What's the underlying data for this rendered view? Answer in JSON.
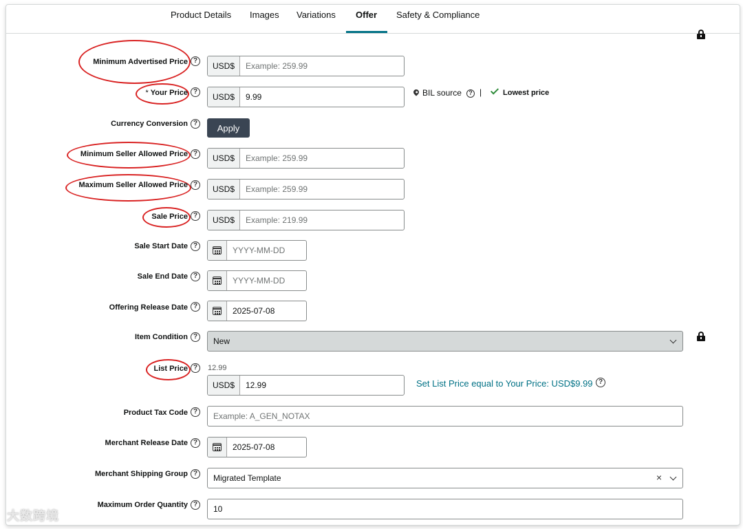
{
  "tabs": [
    {
      "label": "Product Details",
      "active": false
    },
    {
      "label": "Images",
      "active": false
    },
    {
      "label": "Variations",
      "active": false
    },
    {
      "label": "Offer",
      "active": true
    },
    {
      "label": "Safety & Compliance",
      "active": false
    }
  ],
  "accent_color": "#007185",
  "annotation_color": "#d92222",
  "fields": {
    "map": {
      "label": "Minimum Advertised Price",
      "prefix": "USD$",
      "value": "",
      "placeholder": "Example: 259.99"
    },
    "your_price": {
      "required_mark": "*",
      "label": "Your Price",
      "prefix": "USD$",
      "value": "9.99",
      "placeholder": ""
    },
    "currency": {
      "label": "Currency Conversion",
      "button": "Apply"
    },
    "min_seller": {
      "label": "Minimum Seller Allowed Price",
      "prefix": "USD$",
      "value": "",
      "placeholder": "Example: 259.99"
    },
    "max_seller": {
      "label": "Maximum Seller Allowed Price",
      "prefix": "USD$",
      "value": "",
      "placeholder": "Example: 259.99"
    },
    "sale_price": {
      "label": "Sale Price",
      "prefix": "USD$",
      "value": "",
      "placeholder": "Example: 219.99"
    },
    "sale_start": {
      "label": "Sale Start Date",
      "value": "",
      "placeholder": "YYYY-MM-DD"
    },
    "sale_end": {
      "label": "Sale End Date",
      "value": "",
      "placeholder": "YYYY-MM-DD"
    },
    "release_date": {
      "label": "Offering Release Date",
      "value": "2025-07-08",
      "placeholder": ""
    },
    "condition": {
      "label": "Item Condition",
      "value": "New"
    },
    "list_price": {
      "label": "List Price",
      "hint": "12.99",
      "prefix": "USD$",
      "value": "12.99",
      "placeholder": "",
      "suggestion": "Set List Price equal to Your Price: USD$9.99"
    },
    "tax_code": {
      "label": "Product Tax Code",
      "value": "",
      "placeholder": "Example: A_GEN_NOTAX"
    },
    "merchant_release": {
      "label": "Merchant Release Date",
      "value": "2025-07-08",
      "placeholder": ""
    },
    "shipping_group": {
      "label": "Merchant Shipping Group",
      "value": "Migrated Template"
    },
    "max_qty": {
      "label": "Maximum Order Quantity",
      "value": "10",
      "placeholder": ""
    }
  },
  "price_info": {
    "source": "BIL source",
    "separator": "|",
    "badge": "Lowest price"
  },
  "help_glyph": "?",
  "clear_glyph": "×",
  "watermark": "大数跨境"
}
